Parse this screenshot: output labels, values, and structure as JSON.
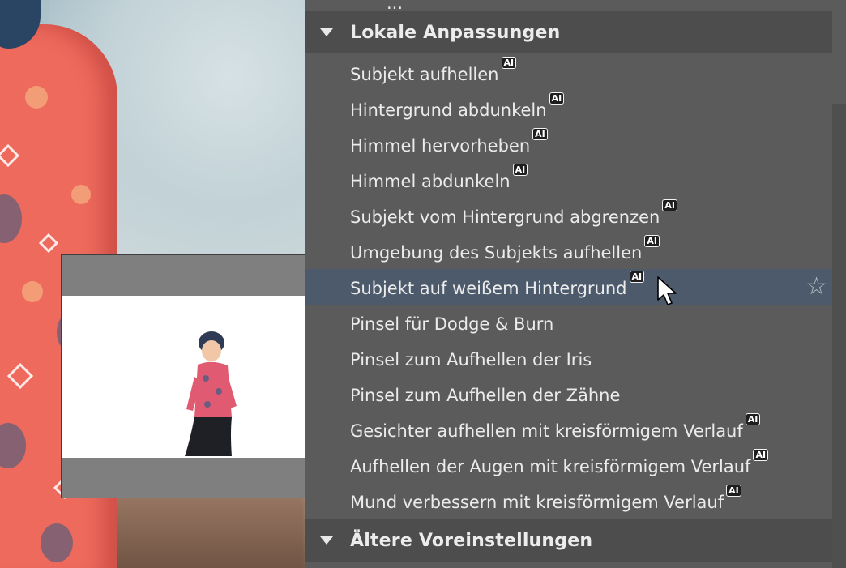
{
  "partial_top_label": "...",
  "sections": {
    "local": {
      "title": "Lokale Anpassungen"
    },
    "older": {
      "title": "Ältere Voreinstellungen"
    }
  },
  "ai_badge": "AI",
  "star_glyph": "☆",
  "items": [
    {
      "label": "Subjekt aufhellen",
      "ai": true
    },
    {
      "label": "Hintergrund abdunkeln",
      "ai": true
    },
    {
      "label": "Himmel hervorheben",
      "ai": true
    },
    {
      "label": "Himmel abdunkeln",
      "ai": true
    },
    {
      "label": "Subjekt vom Hintergrund abgrenzen",
      "ai": true
    },
    {
      "label": "Umgebung des Subjekts aufhellen",
      "ai": true
    },
    {
      "label": "Subjekt auf weißem Hintergrund",
      "ai": true,
      "selected": true
    },
    {
      "label": "Pinsel für Dodge & Burn",
      "ai": false
    },
    {
      "label": "Pinsel zum Aufhellen der Iris",
      "ai": false
    },
    {
      "label": "Pinsel zum Aufhellen der Zähne",
      "ai": false
    },
    {
      "label": "Gesichter aufhellen mit kreisförmigem Verlauf",
      "ai": true
    },
    {
      "label": "Aufhellen der Augen mit kreisförmigem Verlauf",
      "ai": true
    },
    {
      "label": "Mund verbessern mit kreisförmigem Verlauf",
      "ai": true
    }
  ],
  "colors": {
    "panel_bg": "#5b5b5b",
    "header_bg": "#4d4d4d",
    "selected_bg": "#4c5a6c",
    "text": "#ebebeb"
  }
}
